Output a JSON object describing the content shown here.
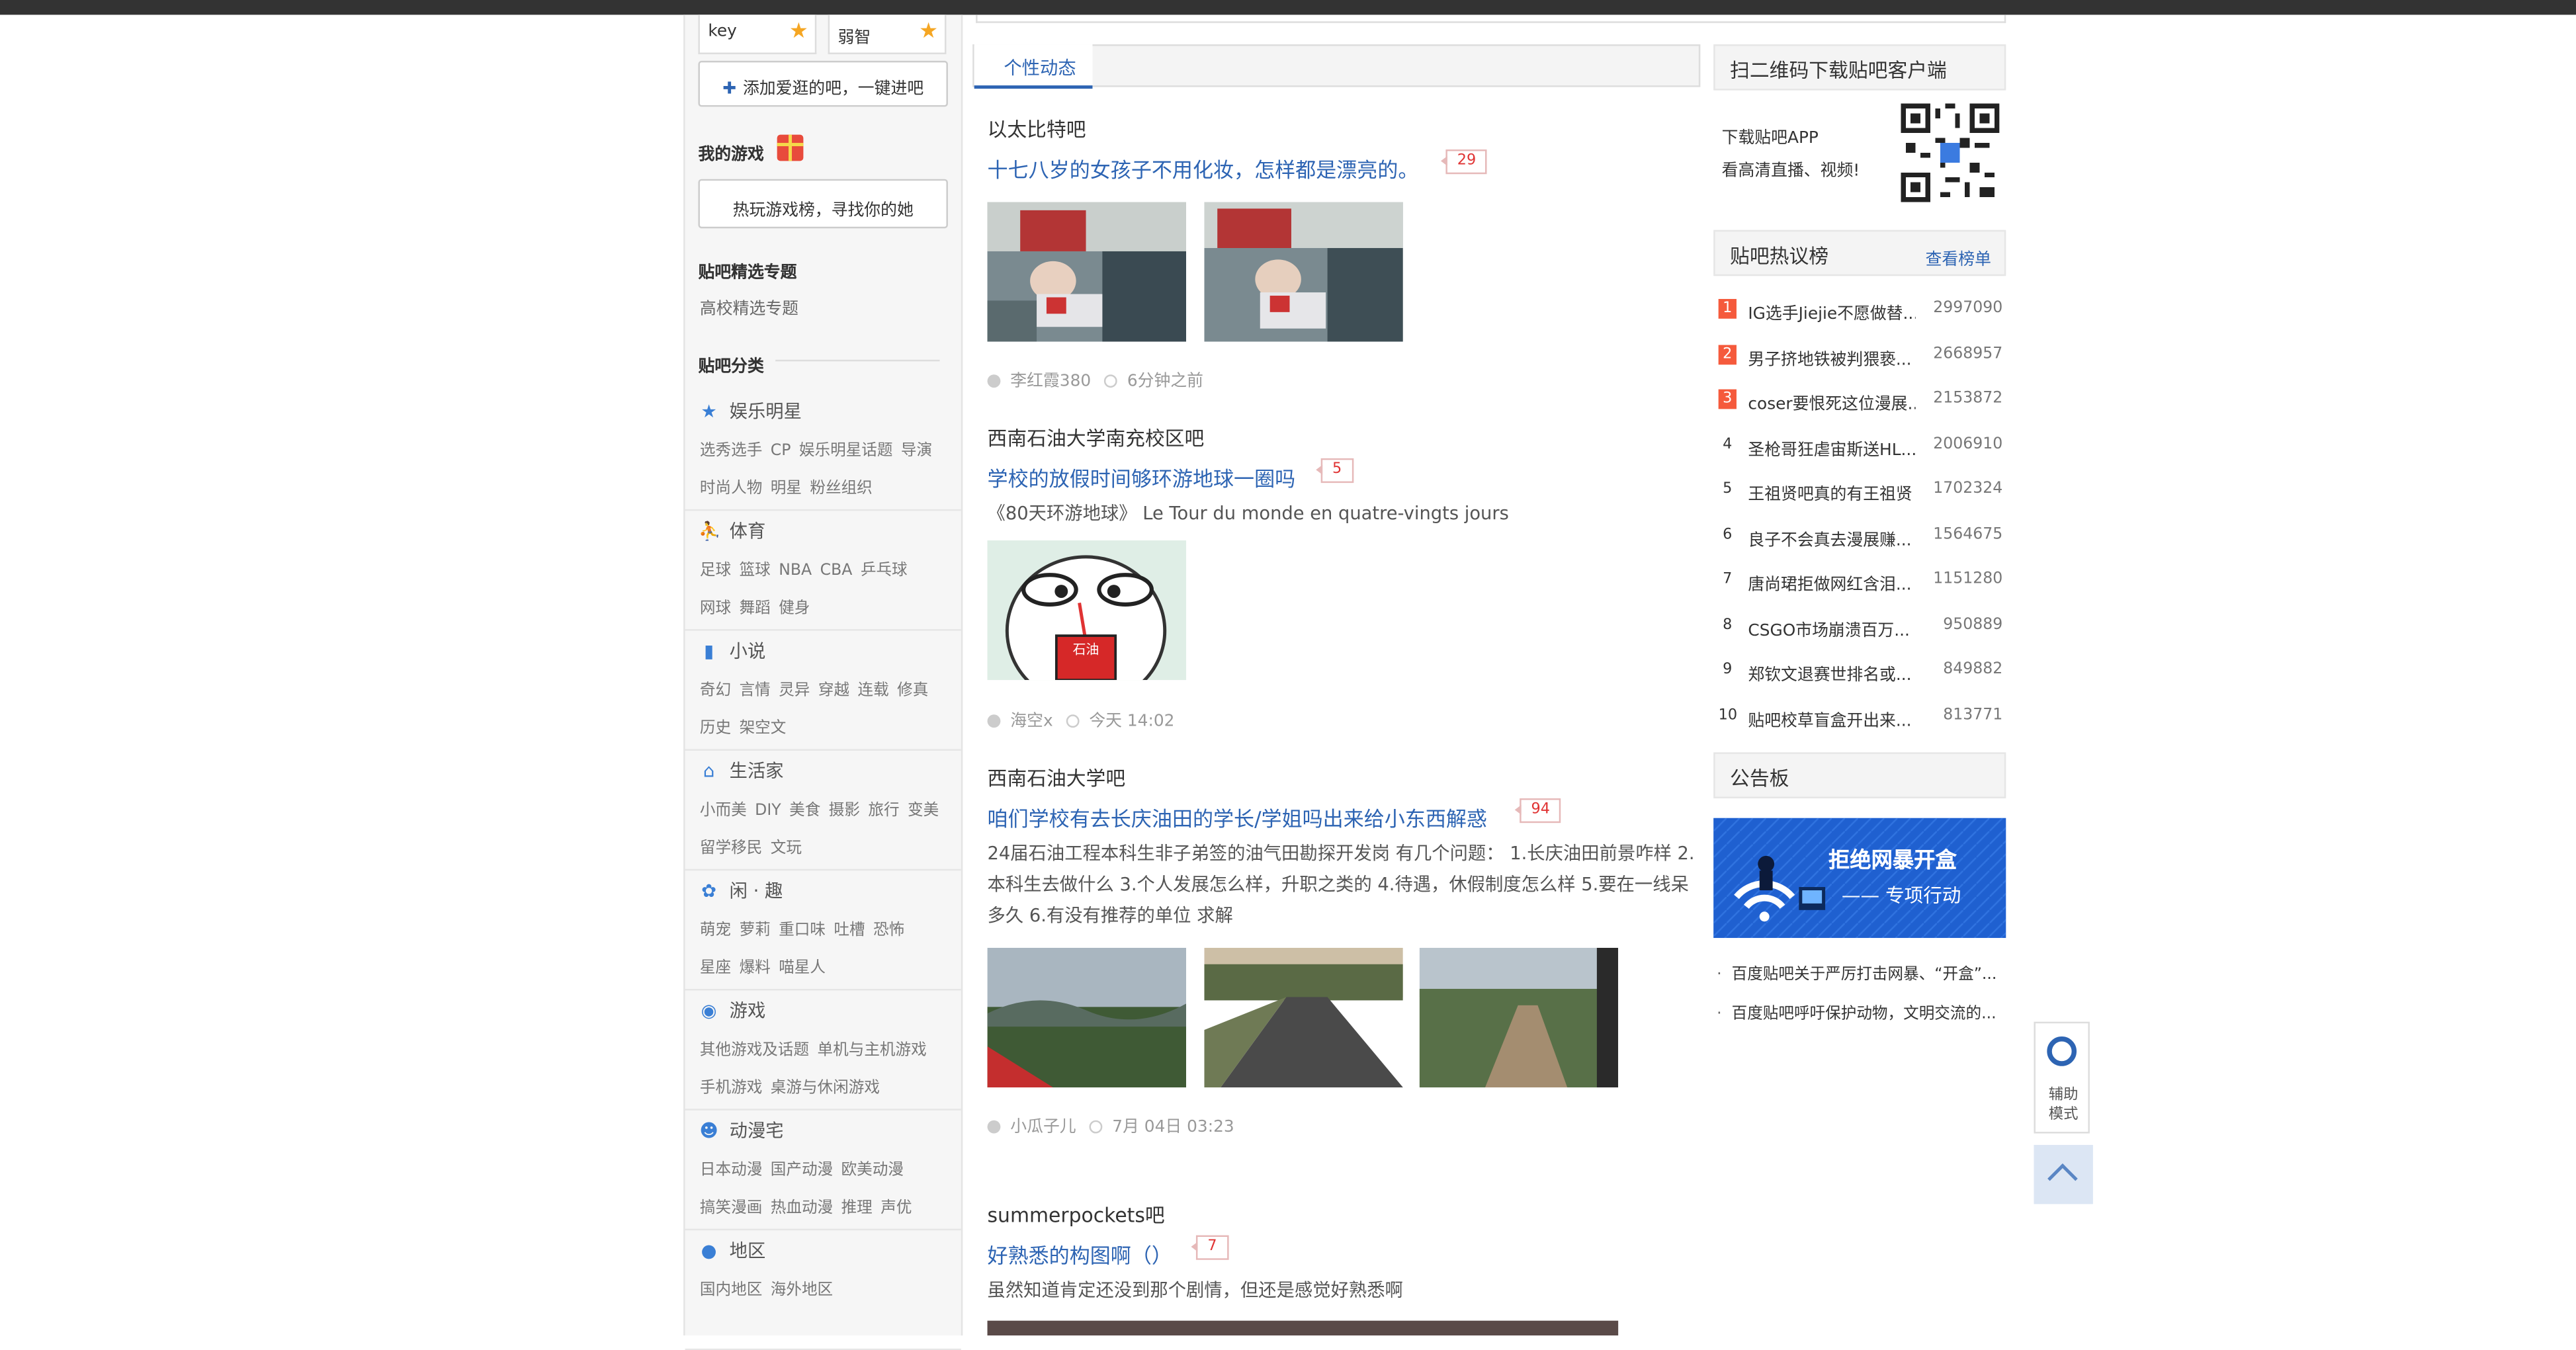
{
  "sidebar": {
    "followed": [
      {
        "name": "key"
      },
      {
        "name": "弱智"
      }
    ],
    "add_forum_label": "添加爱逛的吧，一键进吧",
    "my_games_title": "我的游戏",
    "game_rank_label": "热玩游戏榜，寻找你的她",
    "featured_title": "贴吧精选专题",
    "featured_link": "高校精选专题",
    "categories_title": "贴吧分类",
    "categories": [
      {
        "icon": "star-icon",
        "name": "娱乐明星",
        "line1": [
          "选秀选手",
          "CP",
          "娱乐明星话题",
          "导演"
        ],
        "line2": [
          "时尚人物",
          "明星",
          "粉丝组织"
        ]
      },
      {
        "icon": "sports-icon",
        "name": "体育",
        "line1": [
          "足球",
          "篮球",
          "NBA",
          "CBA",
          "乒乓球"
        ],
        "line2": [
          "网球",
          "舞蹈",
          "健身"
        ]
      },
      {
        "icon": "book-icon",
        "name": "小说",
        "line1": [
          "奇幻",
          "言情",
          "灵异",
          "穿越",
          "连载",
          "修真"
        ],
        "line2": [
          "历史",
          "架空文"
        ]
      },
      {
        "icon": "home-icon",
        "name": "生活家",
        "line1": [
          "小而美",
          "DIY",
          "美食",
          "摄影",
          "旅行",
          "变美"
        ],
        "line2": [
          "留学移民",
          "文玩"
        ]
      },
      {
        "icon": "fun-icon",
        "name": "闲 · 趣",
        "line1": [
          "萌宠",
          "萝莉",
          "重口味",
          "吐槽",
          "恐怖"
        ],
        "line2": [
          "星座",
          "爆料",
          "喵星人"
        ]
      },
      {
        "icon": "gamepad-icon",
        "name": "游戏",
        "line1": [
          "其他游戏及话题",
          "单机与主机游戏"
        ],
        "line2": [
          "手机游戏",
          "桌游与休闲游戏"
        ]
      },
      {
        "icon": "anime-icon",
        "name": "动漫宅",
        "line1": [
          "日本动漫",
          "国产动漫",
          "欧美动漫"
        ],
        "line2": [
          "搞笑漫画",
          "热血动漫",
          "推理",
          "声优"
        ]
      },
      {
        "icon": "location-icon",
        "name": "地区",
        "line1": [
          "国内地区",
          "海外地区"
        ],
        "line2": []
      }
    ]
  },
  "feed": {
    "tab_label": "个性动态",
    "posts": [
      {
        "forum": "以太比特吧",
        "title": "十七八岁的女孩子不用化妆，怎样都是漂亮的。",
        "replies": "29",
        "text": "",
        "author": "李红霞380",
        "time": "6分钟之前"
      },
      {
        "forum": "西南石油大学南充校区吧",
        "title": "学校的放假时间够环游地球一圈吗",
        "replies": "5",
        "text": "《80天环游地球》 Le Tour du monde en quatre-vingts jours",
        "author": "海空x",
        "time": "今天 14:02",
        "sticker_text": "石油"
      },
      {
        "forum": "西南石油大学吧",
        "title": "咱们学校有去长庆油田的学长/学姐吗出来给小东西解惑",
        "replies": "94",
        "text": "24届石油工程本科生非子弟签的油气田勘探开发岗 有几个问题： 1.长庆油田前景咋样 2.本科生去做什么 3.个人发展怎么样，升职之类的 4.待遇，休假制度怎么样 5.要在一线呆多久 6.有没有推荐的单位 求解",
        "author": "小瓜子儿",
        "time": "7月 04日 03:23"
      },
      {
        "forum": "summerpockets吧",
        "title": "好熟悉的构图啊（）",
        "replies": "7",
        "text": "虽然知道肯定还没到那个剧情，但还是感觉好熟悉啊",
        "author": "",
        "time": ""
      }
    ]
  },
  "right": {
    "qr_title": "扫二维码下载贴吧客户端",
    "qr_line1": "下载贴吧APP",
    "qr_line2": "看高清直播、视频!",
    "hot_title": "贴吧热议榜",
    "hot_more": "查看榜单",
    "hot_list": [
      {
        "rank": "1",
        "title": "IG选手Jiejie不愿做替...",
        "count": "2997090"
      },
      {
        "rank": "2",
        "title": "男子挤地铁被判猥亵...",
        "count": "2668957"
      },
      {
        "rank": "3",
        "title": "coser要恨死这位漫展...",
        "count": "2153872"
      },
      {
        "rank": "4",
        "title": "圣枪哥狂虐宙斯送HL...",
        "count": "2006910"
      },
      {
        "rank": "5",
        "title": "王祖贤吧真的有王祖贤",
        "count": "1702324"
      },
      {
        "rank": "6",
        "title": "良子不会真去漫展赚...",
        "count": "1564675"
      },
      {
        "rank": "7",
        "title": "唐尚珺拒做网红含泪...",
        "count": "1151280"
      },
      {
        "rank": "8",
        "title": "CSGO市场崩溃百万...",
        "count": "950889"
      },
      {
        "rank": "9",
        "title": "郑钦文退赛世排名或...",
        "count": "849882"
      },
      {
        "rank": "10",
        "title": "贴吧校草盲盒开出来...",
        "count": "813771"
      }
    ],
    "notice_title": "公告板",
    "banner_line1": "拒绝网暴开盒",
    "banner_line2": "—— 专项行动",
    "notices": [
      "百度贴吧关于严厉打击网暴、“开盒”...",
      "百度贴吧呼吁保护动物，文明交流的..."
    ]
  },
  "floating": {
    "help_line1": "辅助",
    "help_line2": "模式"
  },
  "colors": {
    "link_blue": "#2d64b3",
    "reply_red": "#e03333",
    "hot_orange": "#f55a3c"
  }
}
